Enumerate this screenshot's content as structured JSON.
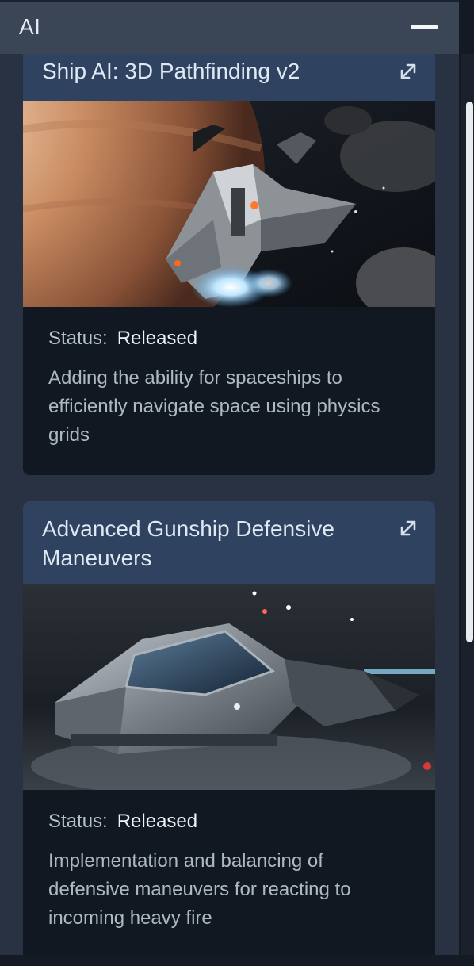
{
  "panel": {
    "title": "AI",
    "collapse_icon": "minus-icon"
  },
  "cards": [
    {
      "title": "Ship AI: 3D Pathfinding v2",
      "link_icon": "external-link-icon",
      "image": "spaceship-near-planet-image",
      "status_label": "Status:",
      "status_value": "Released",
      "description": "Adding the ability for spaceships to efficiently navigate space using physics grids"
    },
    {
      "title": "Advanced Gunship Defensive Maneuvers",
      "link_icon": "external-link-icon",
      "image": "gunship-in-hangar-image",
      "status_label": "Status:",
      "status_value": "Released",
      "description": "Implementation and balancing of defensive maneuvers for reacting to incoming heavy fire"
    }
  ],
  "colors": {
    "panel_bg": "#283242",
    "header_bg": "#3a4656",
    "card_head_bg": "#2f4360",
    "card_bg": "#121822",
    "scrollbar_thumb": "#e9ecef"
  }
}
